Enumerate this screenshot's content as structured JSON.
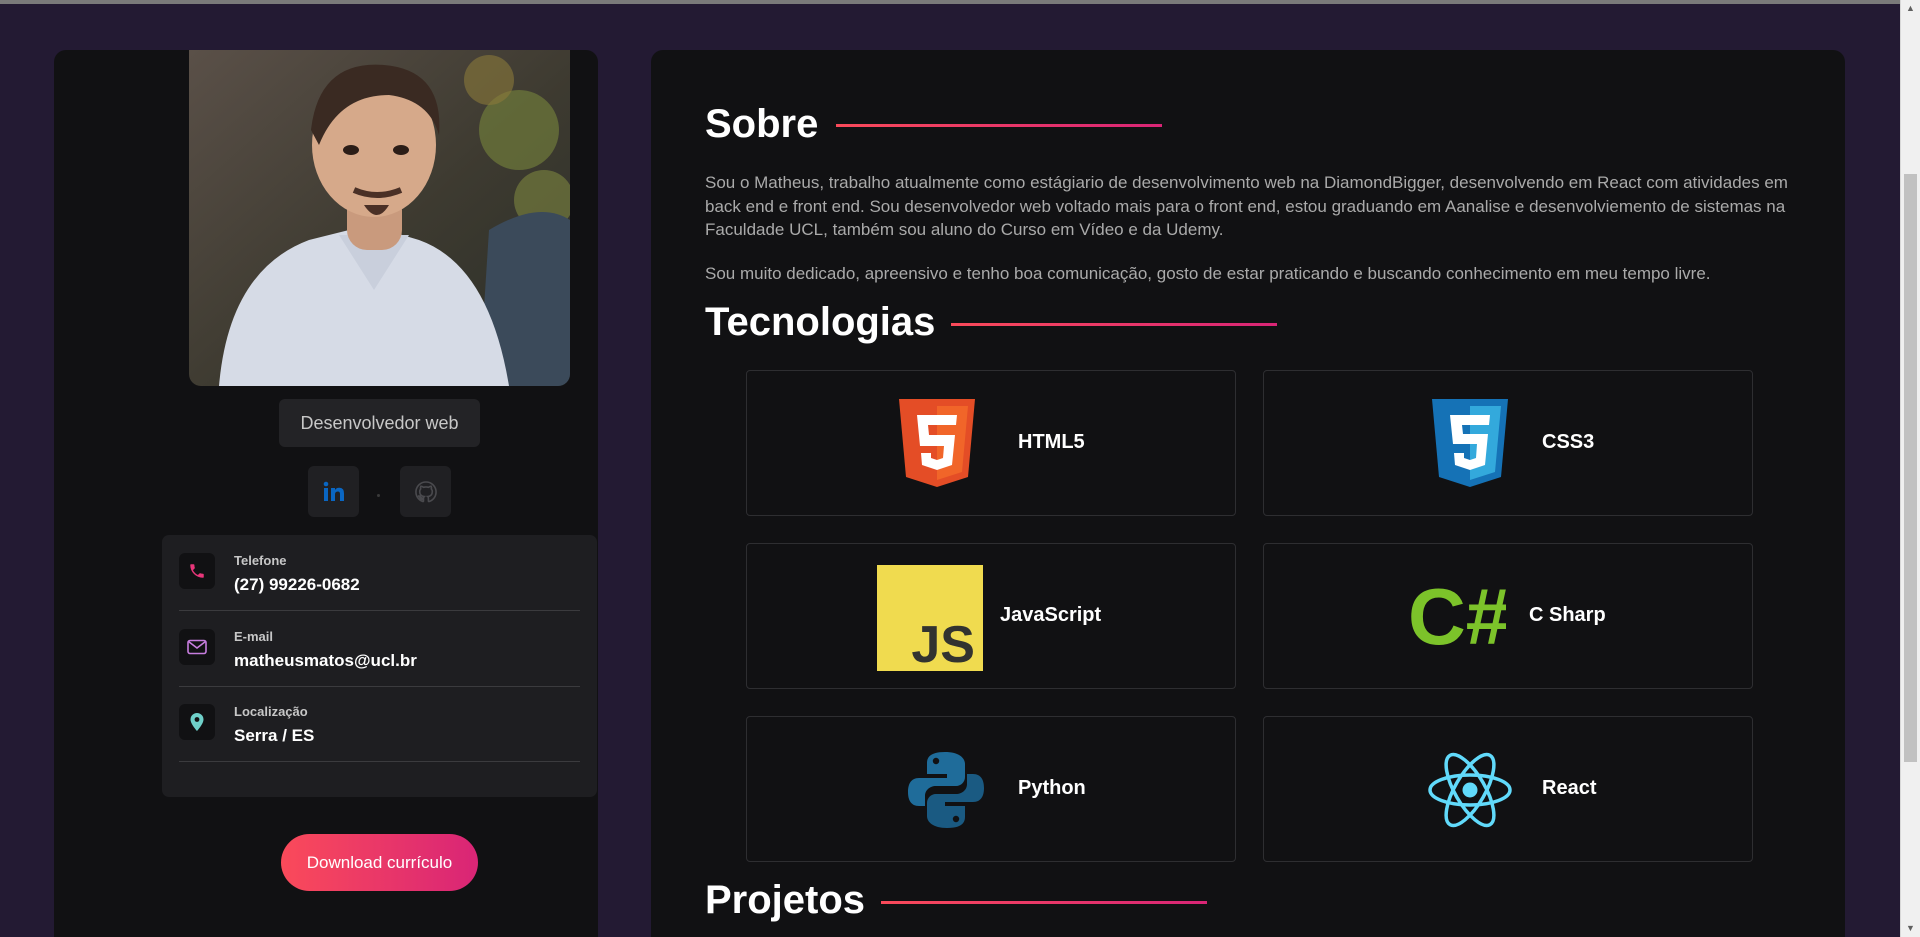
{
  "profile": {
    "role": "Desenvolvedor web",
    "download_label": "Download currículo",
    "social": [
      {
        "name": "LinkedIn",
        "icon": "linkedin-icon"
      },
      {
        "name": "GitHub",
        "icon": "github-icon"
      }
    ],
    "contacts": [
      {
        "label": "Telefone",
        "value": "(27) 99226-0682",
        "icon": "phone-icon",
        "color": "#e8367a"
      },
      {
        "label": "E-mail",
        "value": "matheusmatos@ucl.br",
        "icon": "mail-icon",
        "color": "#c77dde"
      },
      {
        "label": "Localização",
        "value": "Serra / ES",
        "icon": "location-pin-icon",
        "color": "#6fd0c9"
      }
    ]
  },
  "about": {
    "title": "Sobre",
    "paragraphs": [
      "Sou o Matheus, trabalho atualmente como estágiario de desenvolvimento web na DiamondBigger, desenvolvendo em React com atividades em back end e front end. Sou desenvolvedor web voltado mais para o front end, estou graduando em Aanalise e desenvolviemento de sistemas na Faculdade UCL, também sou aluno do Curso em Vídeo e da Udemy.",
      "Sou muito dedicado, apreensivo e tenho boa comunicação, gosto de estar praticando e buscando conhecimento em meu tempo livre."
    ]
  },
  "technologies": {
    "title": "Tecnologias",
    "items": [
      {
        "name": "HTML5",
        "icon": "html5-icon"
      },
      {
        "name": "CSS3",
        "icon": "css3-icon"
      },
      {
        "name": "JavaScript",
        "icon": "javascript-icon"
      },
      {
        "name": "C Sharp",
        "icon": "csharp-icon"
      },
      {
        "name": "Python",
        "icon": "python-icon"
      },
      {
        "name": "React",
        "icon": "react-icon"
      }
    ]
  },
  "projects": {
    "title": "Projetos"
  },
  "colors": {
    "background": "#231a33",
    "card": "#111113",
    "accent_start": "#fa4a5a",
    "accent_end": "#d92576"
  }
}
